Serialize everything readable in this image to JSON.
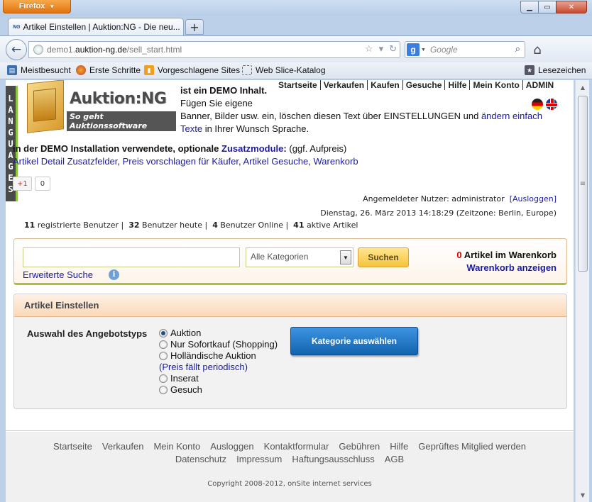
{
  "browser": {
    "menu_button": "Firefox",
    "tab_title": "Artikel Einstellen | Auktion:NG - Die neu...",
    "tab_favicon": "NG",
    "url_host_prefix": "demo1.",
    "url_host": "auktion-ng.de",
    "url_path": "/sell_start.html",
    "search_placeholder": "Google",
    "bookmarks": [
      {
        "label": "Meistbesucht",
        "icon": "bookmarks-folder-icon"
      },
      {
        "label": "Erste Schritte",
        "icon": "firefox-icon"
      },
      {
        "label": "Vorgeschlagene Sites",
        "icon": "suggested-sites-icon"
      },
      {
        "label": "Web Slice-Katalog",
        "icon": "web-slice-icon"
      }
    ],
    "bookmarks_menu": "Lesezeichen"
  },
  "site": {
    "languages_tab": "LANGUAGES",
    "logo_title": "Auktion:NG",
    "logo_tagline": "So geht Auktionssoftware",
    "topnav": [
      "Startseite",
      "Verkaufen",
      "Kaufen",
      "Gesuche",
      "Hilfe",
      "Mein Konto",
      "ADMIN"
    ],
    "intro": {
      "bold": "ist ein DEMO Inhalt",
      "line2": "Fügen Sie eigene",
      "line3_prefix": "Banner, Bilder usw. ein, löschen diesen Text über EINSTELLUNGEN und ",
      "link": "ändern einfach Texte",
      "line3_suffix": " in Ihrer Wunsch Sprache."
    },
    "modules": {
      "text": "in der DEMO Installation verwendete, optionale ",
      "link": "Zusatzmodule",
      "suffix": " (ggf. Aufpreis)",
      "items": [
        "Artikel Detail Zusatzfelder",
        "Preis vorschlagen für Käufer",
        "Artikel Gesuche",
        "Warenkorb"
      ]
    },
    "plusone": {
      "label": "+1",
      "count": "0"
    },
    "user": {
      "label": "Angemeldeter Nutzer: administrator",
      "logout": "[Ausloggen]",
      "datetime": "Dienstag, 26. März 2013 14:18:29 (Zeitzone: Berlin, Europe)"
    },
    "stats": {
      "registered_count": "11",
      "registered_label": "registrierte Benutzer",
      "today_count": "32",
      "today_label": "Benutzer heute",
      "online_count": "4",
      "online_label": "Benutzer Online",
      "active_count": "41",
      "active_label": "aktive Artikel"
    },
    "search": {
      "input_value": "",
      "category_selected": "Alle Kategorien",
      "button": "Suchen",
      "advanced": "Erweiterte Suche",
      "cart_count": "0",
      "cart_label": "Artikel im Warenkorb",
      "cart_link": "Warenkorb anzeigen"
    },
    "panel": {
      "title": "Artikel Einstellen",
      "offer_type_label": "Auswahl des Angebotstyps",
      "options": [
        "Auktion",
        "Nur Sofortkauf (Shopping)",
        "Holländische Auktion",
        "Inserat",
        "Gesuch"
      ],
      "dutch_note": "(Preis fällt periodisch)",
      "selected_index": 0,
      "category_button": "Kategorie auswählen"
    },
    "footer": {
      "links_row1": [
        "Startseite",
        "Verkaufen",
        "Mein Konto",
        "Ausloggen",
        "Kontaktformular",
        "Gebühren",
        "Hilfe",
        "Geprüftes Mitglied werden"
      ],
      "links_row2": [
        "Datenschutz",
        "Impressum",
        "Haftungsausschluss",
        "AGB"
      ],
      "copyright": "Copyright 2008-2012, onSite internet services"
    }
  }
}
